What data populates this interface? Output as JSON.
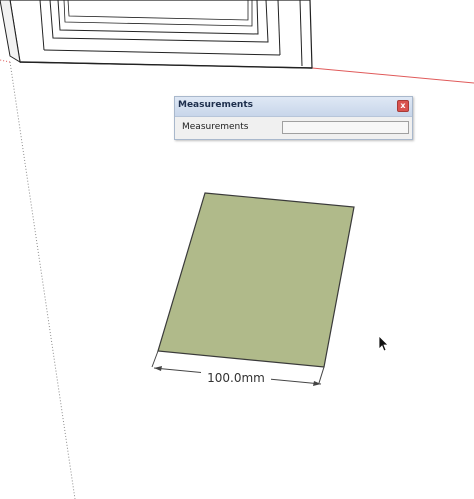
{
  "measurements_window": {
    "title": "Measurements",
    "close_glyph": "x",
    "field_label": "Measurements",
    "field_value": ""
  },
  "dimension": {
    "label": "100.0mm"
  },
  "colors": {
    "rectangle_fill": "#b0ba8a",
    "rectangle_edge": "#3a3a3a",
    "red_axis": "#e05a5a",
    "blue_axis_dotted": "#5a6fbf",
    "window_titlebar": "#c8d6ea"
  },
  "icons": {
    "pointer": "mouse-cursor-icon",
    "close": "close-icon"
  }
}
